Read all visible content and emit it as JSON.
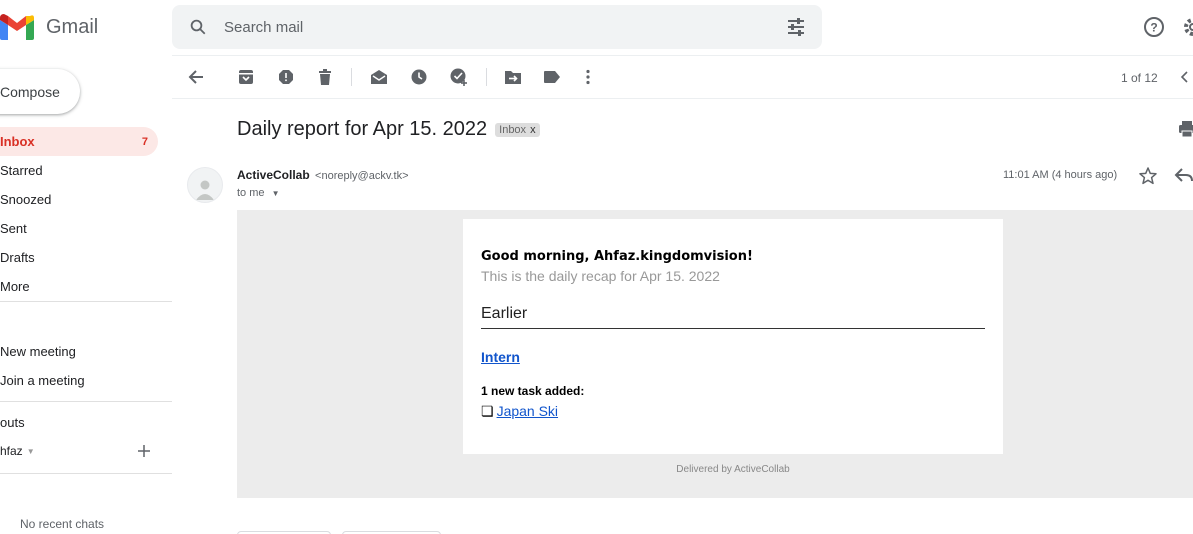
{
  "app": {
    "name": "Gmail"
  },
  "colors": {
    "accent_red": "#d93025",
    "link_blue": "#1155cc"
  },
  "search": {
    "placeholder": "Search mail"
  },
  "sidebar": {
    "compose_label": "Compose",
    "items": [
      {
        "label": "Inbox",
        "count": "7",
        "active": true
      },
      {
        "label": "Starred"
      },
      {
        "label": "Snoozed"
      },
      {
        "label": "Sent"
      },
      {
        "label": "Drafts"
      },
      {
        "label": "More"
      }
    ],
    "meet": {
      "new_meeting": "New meeting",
      "join_meeting": "Join a meeting"
    },
    "hangouts": {
      "title": "outs",
      "user": "hfaz",
      "no_recent_chats": "No recent chats"
    }
  },
  "toolbar": {
    "icons": [
      "back-arrow-icon",
      "archive-icon",
      "report-spam-icon",
      "delete-icon",
      "mark-unread-icon",
      "snooze-icon",
      "add-task-icon",
      "move-to-icon",
      "label-icon",
      "more-vert-icon"
    ],
    "pager": "1 of 12"
  },
  "message": {
    "subject": "Daily report for Apr 15. 2022",
    "label": "Inbox",
    "label_close": "x",
    "sender_name": "ActiveCollab",
    "sender_email": "<noreply@ackv.tk>",
    "to": "to me",
    "time": "11:01 AM (4 hours ago)"
  },
  "email": {
    "greeting": "Good morning, Ahfaz.kingdomvision!",
    "recap": "This is the daily recap for Apr 15. 2022",
    "section": "Earlier",
    "project": "Intern",
    "task_heading": "1 new task added:",
    "task_bullet": "❏",
    "task_name": "Japan Ski",
    "footer": "Delivered by ActiveCollab"
  }
}
